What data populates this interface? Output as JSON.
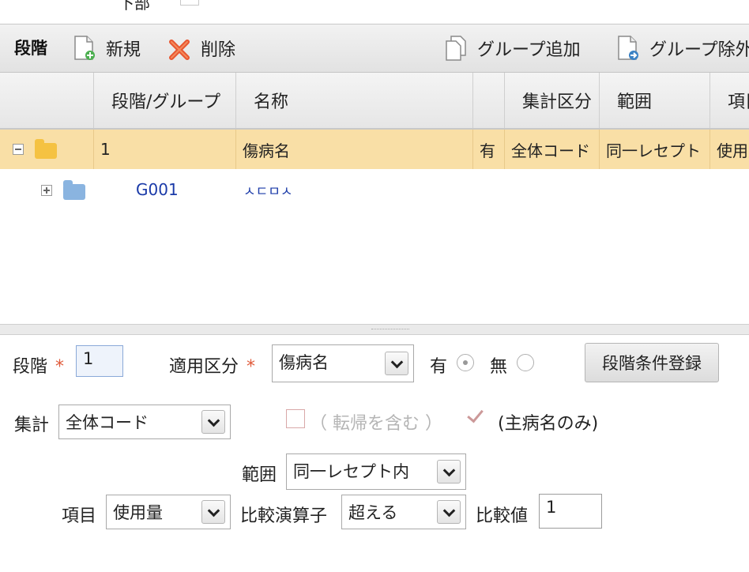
{
  "top_row": {
    "label": "下部"
  },
  "toolbar": {
    "title": "段階",
    "new_label": "新規",
    "delete_label": "削除",
    "group_add_label": "グループ追加",
    "group_remove_label": "グループ除外"
  },
  "grid": {
    "columns": [
      "段階/グループ",
      "名称",
      "",
      "集計区分",
      "範囲",
      "項目"
    ],
    "rows": [
      {
        "stage": "1",
        "name": "傷病名",
        "flag": "有",
        "aggregation": "全体コード",
        "range": "同一レセプト",
        "item": "使用量",
        "expanded": true
      },
      {
        "group": "G001",
        "name": "ㅅㄷㅁㅅ",
        "expanded": false
      }
    ]
  },
  "form": {
    "stage_label": "段階",
    "stage_value": "1",
    "required_mark": "*",
    "apply_type_label": "適用区分",
    "apply_type_value": "傷病名",
    "yes_label": "有",
    "no_label": "無",
    "register_button": "段階条件登録",
    "aggregation_label": "集計",
    "aggregation_value": "全体コード",
    "include_transfer_label": "（ 転帰を含む ）",
    "main_disease_only_label": "(主病名のみ)",
    "range_label": "範囲",
    "range_value": "同一レセプト内",
    "item_label": "項目",
    "item_value": "使用量",
    "operator_label": "比較演算子",
    "operator_value": "超える",
    "compare_value_label": "比較値",
    "compare_value": "1"
  },
  "colors": {
    "selected_row": "#f9dfa6",
    "folder_open": "#f5c242",
    "folder_closed": "#8ab4e0",
    "link_text": "#1a3aa8",
    "required": "#e05a3a"
  }
}
